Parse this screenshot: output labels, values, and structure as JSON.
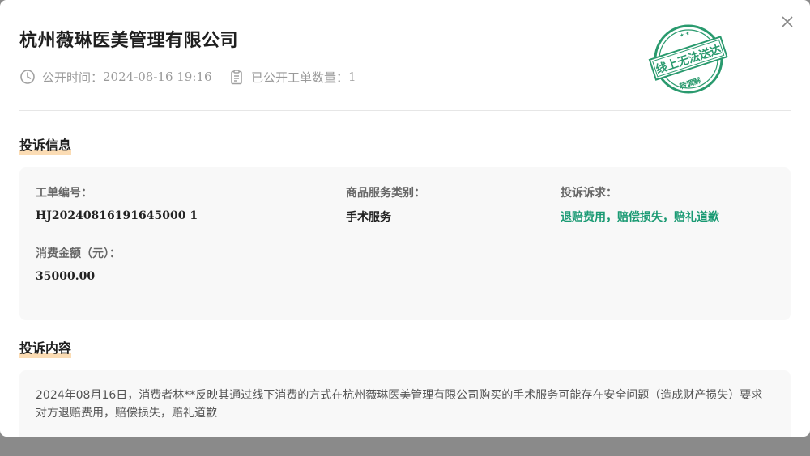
{
  "dialog": {
    "title": "杭州薇琳医美管理有限公司",
    "publish_time_label": "公开时间：",
    "publish_time": "2024-08-16 19:16",
    "ticket_count_label": "已公开工单数量：",
    "ticket_count": "1",
    "stamp_main": "线上无法送达",
    "stamp_sub": "转调解"
  },
  "complaint_info": {
    "section_title": "投诉信息",
    "ticket_no_label": "工单编号：",
    "ticket_no": "HJ20240816191645000 1",
    "category_label": "商品服务类别：",
    "category": "手术服务",
    "demand_label": "投诉诉求：",
    "demand": "退赔费用，赔偿损失，赔礼道歉",
    "amount_label": "消费金额（元）：",
    "amount": "35000.00"
  },
  "complaint_content": {
    "section_title": "投诉内容",
    "text": "2024年08月16日，消费者林**反映其通过线下消费的方式在杭州薇琳医美管理有限公司购买的手术服务可能存在安全问题（造成财产损失）要求对方退赔费用，赔偿损失，赔礼道歉"
  },
  "colors": {
    "accent_green": "#1a9a73",
    "highlight": "#fbdcb4"
  }
}
